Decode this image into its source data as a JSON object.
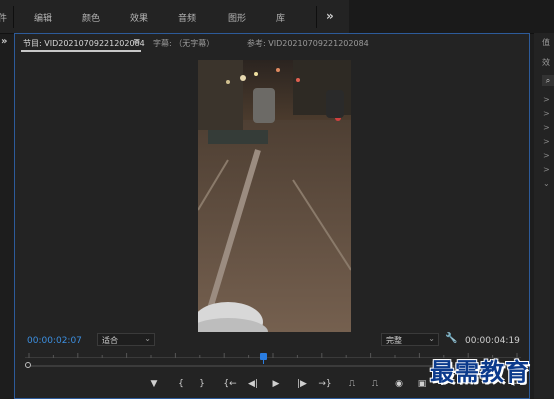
{
  "workspace_tabs": [
    "件",
    "编辑",
    "颜色",
    "效果",
    "音频",
    "图形",
    "库"
  ],
  "workspace_more": "»",
  "left_expand": "»",
  "panel_tabs": {
    "program": "节目: VID20210709221202084",
    "menu": "≡",
    "captions": "字幕: （无字幕）",
    "reference": "参考: VID20210709221202084"
  },
  "timecode": {
    "current": "00:00:02:07",
    "duration": "00:00:04:19"
  },
  "fit_dropdown": {
    "value": "适合"
  },
  "resolution_dropdown": {
    "value": "完整"
  },
  "playhead_position": 0.48,
  "transport": {
    "buttons": [
      {
        "name": "add-marker-button",
        "icon": "▼"
      },
      {
        "name": "mark-in-button",
        "icon": "{"
      },
      {
        "name": "mark-out-button",
        "icon": "}"
      },
      {
        "name": "go-to-in-button",
        "icon": "{←"
      },
      {
        "name": "step-back-button",
        "icon": "◀|"
      },
      {
        "name": "play-button",
        "icon": "▶"
      },
      {
        "name": "step-forward-button",
        "icon": "|▶"
      },
      {
        "name": "go-to-out-button",
        "icon": "→}"
      },
      {
        "name": "lift-button",
        "icon": "⎍"
      },
      {
        "name": "extract-button",
        "icon": "⎍"
      },
      {
        "name": "export-frame-button",
        "icon": "◉"
      },
      {
        "name": "compare-button",
        "icon": "▣"
      },
      {
        "name": "add-button",
        "icon": "+"
      }
    ]
  },
  "right_panel": {
    "label": "值",
    "label2": "效",
    "search_icon": "⌕",
    "chevrons": [
      ">",
      ">",
      ">",
      ">",
      ">",
      ">",
      "⌄"
    ]
  },
  "watermark": "最需教育",
  "colors": {
    "accent": "#2a7de1",
    "timecode": "#3c8fe0",
    "panel_border": "#2d5b9a",
    "watermark": "#0b3a8c"
  }
}
